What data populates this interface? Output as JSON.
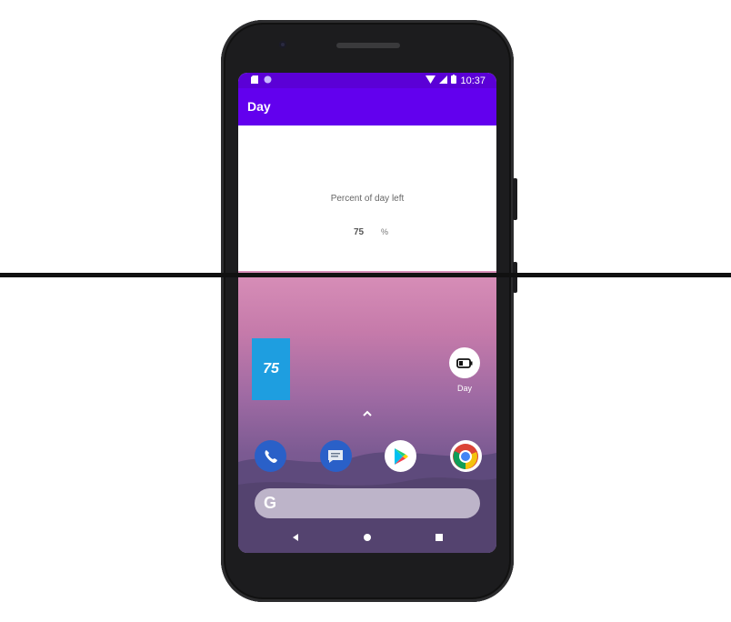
{
  "status_bar": {
    "time": "10:37"
  },
  "app_bar": {
    "title": "Day"
  },
  "main": {
    "label": "Percent of day left",
    "value": "75",
    "unit": "%"
  },
  "home_screen": {
    "widget_value": "75",
    "app_shortcut_label": "Day",
    "dock_apps": [
      "phone-icon",
      "messages-icon",
      "play-store-icon",
      "chrome-icon"
    ],
    "search_logo": "G"
  },
  "colors": {
    "status_bar": "#5b00d6",
    "app_bar": "#6200ee",
    "widget": "#1e9ee0"
  }
}
